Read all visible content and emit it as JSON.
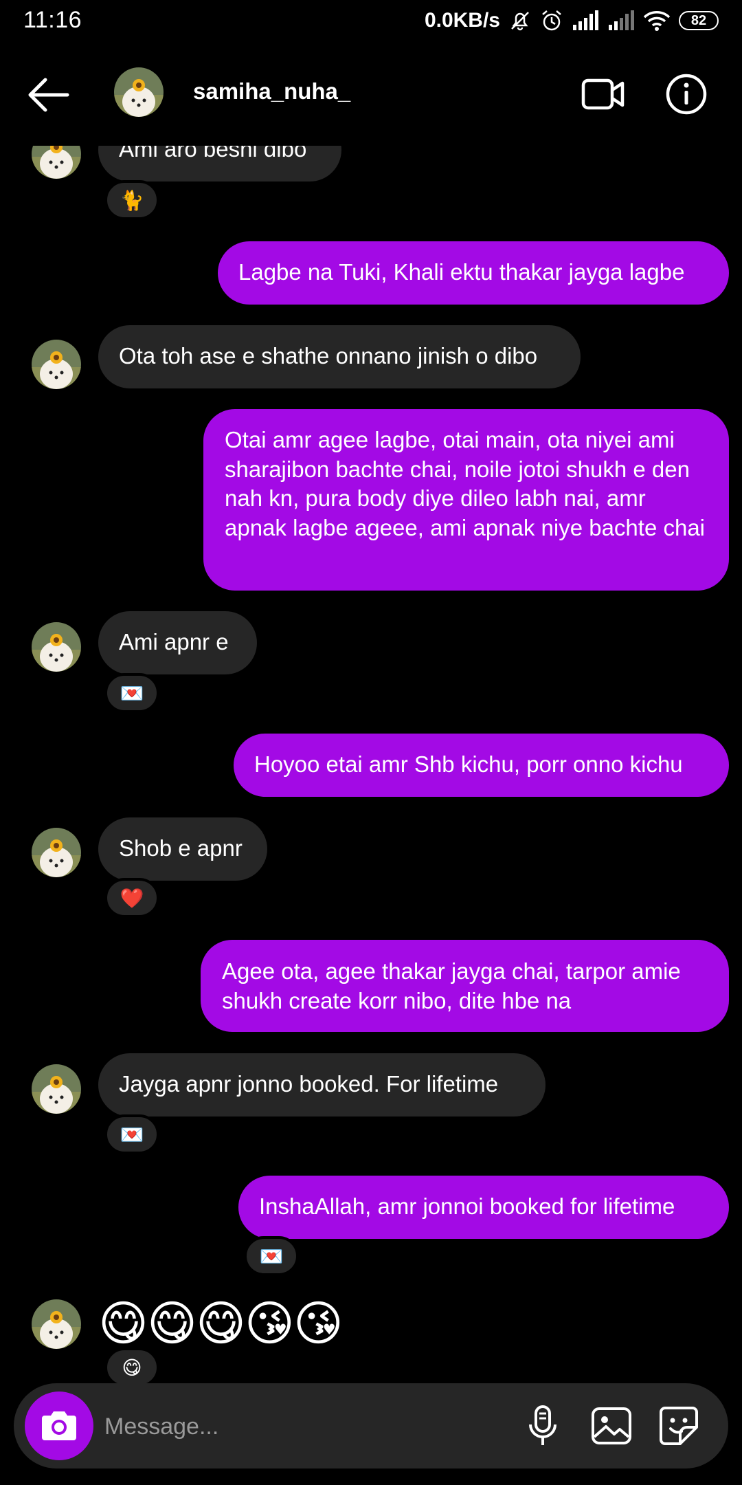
{
  "status_bar": {
    "time": "11:16",
    "net_speed": "0.0KB/s",
    "battery": "82",
    "icons": [
      "mute-icon",
      "alarm-icon",
      "signal-icon",
      "signal-icon",
      "wifi-icon",
      "battery-icon"
    ]
  },
  "header": {
    "username": "samiha_nuha_",
    "icons": [
      "back-arrow-icon",
      "video-call-icon",
      "info-icon"
    ]
  },
  "messages": [
    {
      "from": "them",
      "text": "Ami aro beshi dibo",
      "reaction": "🐈"
    },
    {
      "from": "me",
      "text": "Lagbe na Tuki, Khali ektu thakar jayga lagbe"
    },
    {
      "from": "them",
      "text": "Ota toh ase e shathe onnano jinish o dibo"
    },
    {
      "from": "me",
      "text": "Otai amr agee lagbe, otai main, ota niyei ami sharajibon bachte chai, noile jotoi shukh e den nah kn, pura body diye dileo labh nai, amr apnak lagbe ageee, ami apnak niye bachte chai"
    },
    {
      "from": "them",
      "text": "Ami apnr e",
      "reaction": "💌"
    },
    {
      "from": "me",
      "text": "Hoyoo etai amr Shb kichu, porr onno kichu"
    },
    {
      "from": "them",
      "text": "Shob e apnr",
      "reaction": "❤️"
    },
    {
      "from": "me",
      "text": "Agee ota, agee thakar jayga chai, tarpor amie shukh create korr nibo, dite hbe na"
    },
    {
      "from": "them",
      "text": "Jayga apnr jonno booked. For lifetime",
      "reaction": "💌"
    },
    {
      "from": "me",
      "text": "InshaAllah, amr jonnoi booked for lifetime",
      "reaction": "💌"
    },
    {
      "from": "them",
      "text": "😋😋😋😘😘",
      "reaction": "😋"
    }
  ],
  "composer": {
    "placeholder": "Message...",
    "icons": [
      "camera-icon",
      "microphone-icon",
      "gallery-icon",
      "sticker-icon"
    ]
  },
  "colors": {
    "background": "#000000",
    "incoming_bubble": "#262626",
    "outgoing_bubble": "#a30ae5",
    "camera_button": "#a30ae5"
  }
}
